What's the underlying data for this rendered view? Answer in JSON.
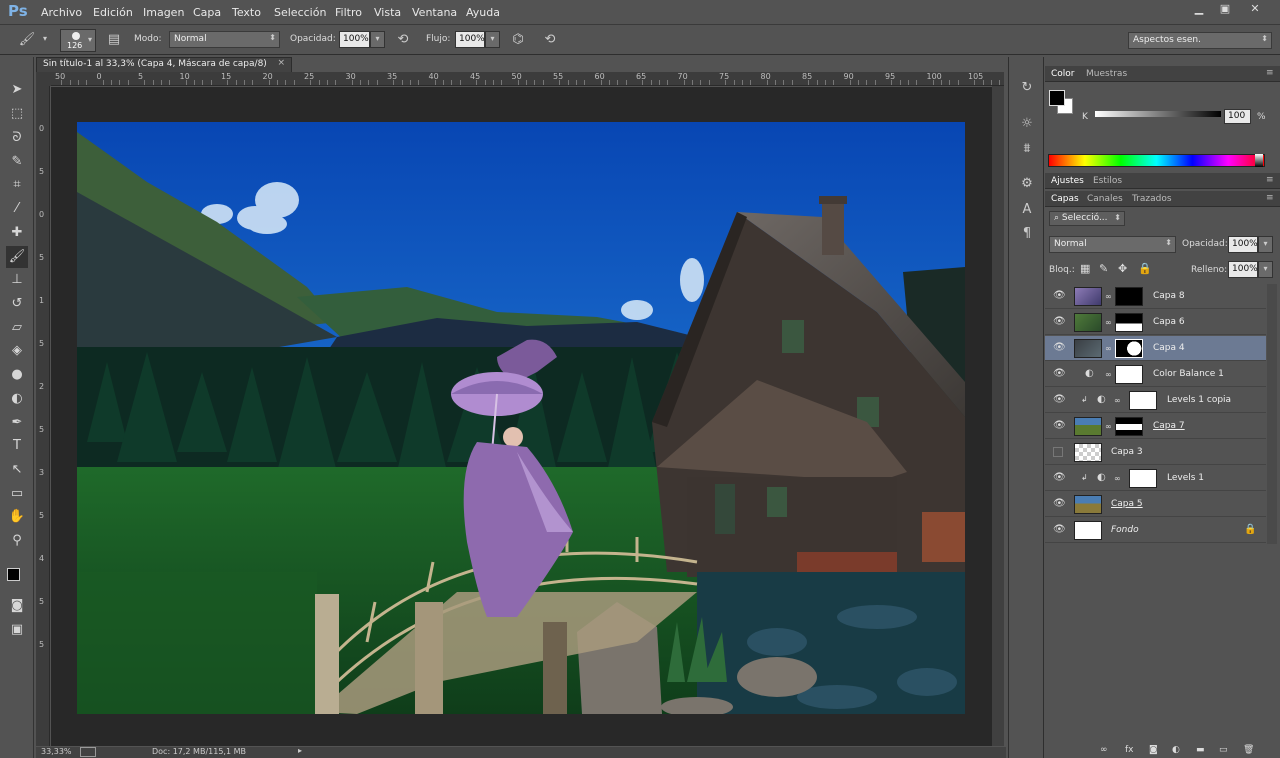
{
  "app": {
    "logo": "Ps"
  },
  "menu": [
    "Archivo",
    "Edición",
    "Imagen",
    "Capa",
    "Texto",
    "Selección",
    "Filtro",
    "Vista",
    "Ventana",
    "Ayuda"
  ],
  "window_controls": {
    "minimize": "▁",
    "restore": "▣",
    "close": "✕"
  },
  "options": {
    "brush_size": "126",
    "mode_label": "Modo:",
    "mode_value": "Normal",
    "opacity_label": "Opacidad:",
    "opacity_value": "100%",
    "flow_label": "Flujo:",
    "flow_value": "100%",
    "workspace": "Aspectos esen."
  },
  "document": {
    "tab_title": "Sin título-1 al 33,3% (Capa 4, Máscara de capa/8)",
    "close": "×",
    "ruler_h": [
      "50",
      "0",
      "5",
      "10",
      "15",
      "20",
      "25",
      "30",
      "35",
      "40",
      "45",
      "50",
      "55",
      "60",
      "65",
      "70",
      "75",
      "80",
      "85",
      "90",
      "95",
      "100",
      "105"
    ],
    "ruler_v": [
      "0",
      "5",
      "0",
      "5",
      "1",
      "5",
      "2",
      "5",
      "3",
      "5",
      "4",
      "5",
      "5"
    ]
  },
  "status": {
    "zoom": "33,33%",
    "doc": "Doc: 17,2 MB/115,1 MB"
  },
  "color_panel": {
    "tabs": [
      "Color",
      "Muestras"
    ],
    "channel": "K",
    "value": "100",
    "unit": "%"
  },
  "adjust_tabs": [
    "Ajustes",
    "Estilos"
  ],
  "layers_panel": {
    "tabs": [
      "Capas",
      "Canales",
      "Trazados"
    ],
    "filter_placeholder": "Selecció...",
    "blend_mode": "Normal",
    "opacity_label": "Opacidad:",
    "opacity_value": "100%",
    "lock_label": "Bloq.:",
    "fill_label": "Relleno:",
    "fill_value": "100%",
    "layers": [
      {
        "name": "Capa 8",
        "visible": true
      },
      {
        "name": "Capa 6",
        "visible": true
      },
      {
        "name": "Capa 4",
        "visible": true,
        "selected": true
      },
      {
        "name": "Color Balance 1",
        "visible": true
      },
      {
        "name": "Levels 1 copia",
        "visible": true
      },
      {
        "name": "Capa 7",
        "visible": true
      },
      {
        "name": "Capa 3",
        "visible": false
      },
      {
        "name": "Levels 1",
        "visible": true
      },
      {
        "name": "Capa 5",
        "visible": true
      },
      {
        "name": "Fondo",
        "visible": true
      }
    ]
  },
  "colors": {
    "accent": "#6c7a93",
    "panel": "#535353",
    "pasteboard": "#282828",
    "sky": "#0a3f9c"
  }
}
